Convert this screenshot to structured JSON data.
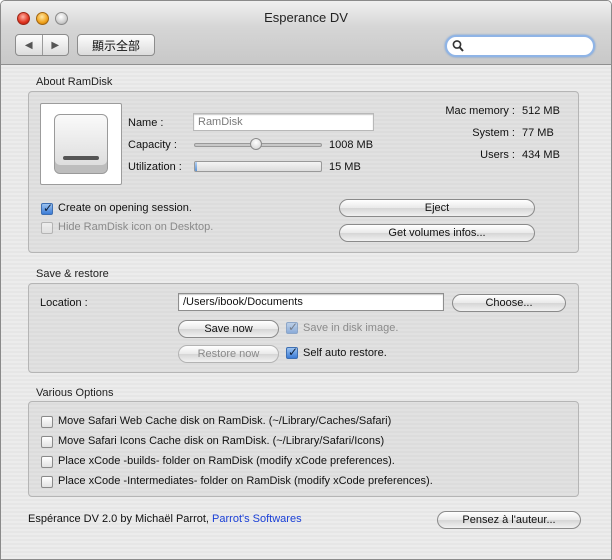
{
  "window": {
    "title": "Esperance DV"
  },
  "toolbar": {
    "back_icon": "◀",
    "forward_icon": "▶",
    "show_all_label": "顯示全部",
    "search_value": ""
  },
  "about": {
    "section_label": "About RamDisk",
    "name_label": "Name :",
    "name_value": "RamDisk",
    "capacity_label": "Capacity :",
    "capacity_value": "1008 MB",
    "capacity_slider_fraction": 0.45,
    "utilization_label": "Utilization :",
    "utilization_value": "15 MB",
    "utilization_fraction": 0.015,
    "mac_memory_label": "Mac memory :",
    "mac_memory_value": "512 MB",
    "system_label": "System :",
    "system_value": "77 MB",
    "users_label": "Users :",
    "users_value": "434 MB",
    "create_on_opening_label": "Create on opening session.",
    "hide_icon_label": "Hide RamDisk icon on Desktop.",
    "eject_label": "Eject",
    "get_volumes_label": "Get volumes infos..."
  },
  "save_restore": {
    "section_label": "Save & restore",
    "location_label": "Location :",
    "location_value": "/Users/ibook/Documents",
    "choose_label": "Choose...",
    "save_now_label": "Save now",
    "restore_now_label": "Restore now",
    "save_in_disk_image_label": "Save in disk image.",
    "self_auto_restore_label": "Self auto restore."
  },
  "options": {
    "section_label": "Various Options",
    "items": [
      "Move Safari Web Cache disk on RamDisk. (~/Library/Caches/Safari)",
      "Move Safari Icons Cache disk on RamDisk. (~/Library/Safari/Icons)",
      "Place xCode -builds- folder on RamDisk (modify xCode preferences).",
      "Place xCode -Intermediates- folder on RamDisk (modify xCode preferences)."
    ]
  },
  "footer": {
    "credit_text": "Espérance DV 2.0 by Michaël Parrot,",
    "credit_link": "Parrot's Softwares",
    "author_button_label": "Pensez à l'auteur..."
  },
  "colors": {
    "link": "#1a3fd6",
    "accent": "#3b7bd6"
  }
}
